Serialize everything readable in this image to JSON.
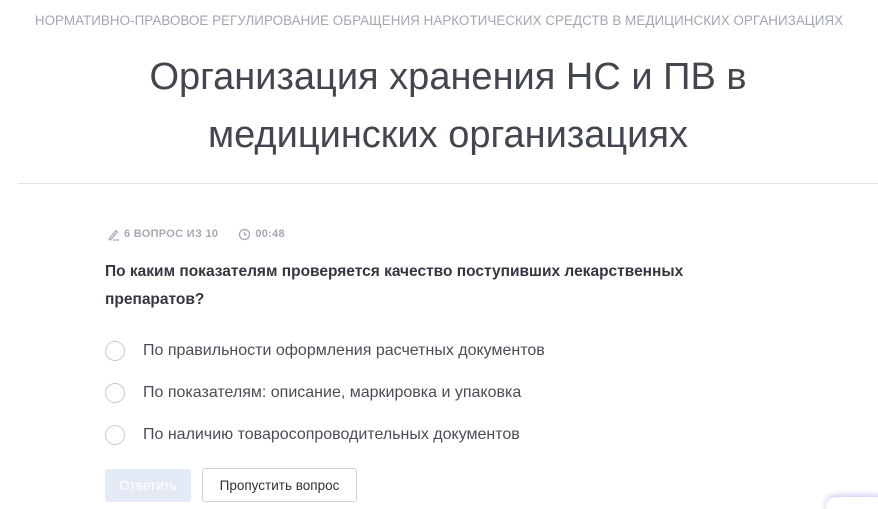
{
  "header": {
    "breadcrumb": "НОРМАТИВНО-ПРАВОВОЕ РЕГУЛИРОВАНИЕ ОБРАЩЕНИЯ НАРКОТИЧЕСКИХ СРЕДСТВ В МЕДИЦИНСКИХ ОРГАНИЗАЦИЯХ",
    "title_line1": "Организация хранения НС и ПВ в",
    "title_line2": "медицинских организациях"
  },
  "quiz": {
    "progress": "6 ВОПРОС ИЗ 10",
    "progress_icon": "pencil-icon",
    "timer": "00:48",
    "timer_icon": "clock-icon",
    "question": "По каким показателям проверяется качество поступивших лекарственных препаратов?",
    "options": [
      {
        "label": "По правильности оформления расчетных документов",
        "selected": false
      },
      {
        "label": "По показателям: описание, маркировка и упаковка",
        "selected": false
      },
      {
        "label": "По наличию товаросопроводительных документов",
        "selected": false
      }
    ],
    "answer_label": "Ответить",
    "answer_disabled": true,
    "skip_label": "Пропустить вопрос"
  },
  "colors": {
    "accent_disabled": "#e4e9f6",
    "text_muted": "#a3a6b3",
    "text_main": "#343741"
  }
}
